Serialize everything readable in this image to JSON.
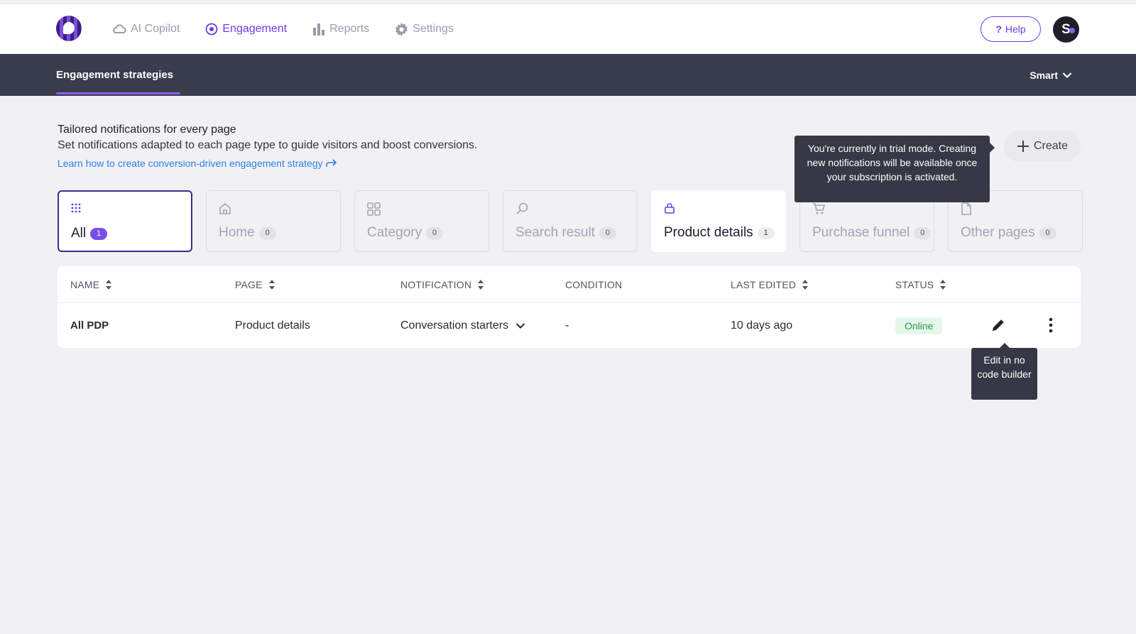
{
  "nav": {
    "items": [
      {
        "label": "AI Copilot",
        "icon": "cloud-icon",
        "active": false
      },
      {
        "label": "Engagement",
        "icon": "target-icon",
        "active": true
      },
      {
        "label": "Reports",
        "icon": "bar-chart-icon",
        "active": false
      },
      {
        "label": "Settings",
        "icon": "gear-icon",
        "active": false
      }
    ],
    "help_label": "Help",
    "avatar_initial": "S"
  },
  "subheader": {
    "tab_label": "Engagement strategies",
    "account_label": "Smart"
  },
  "intro": {
    "title": "Tailored notifications for every page",
    "description": "Set notifications adapted to each page type to guide visitors and boost conversions.",
    "link": "Learn how to create conversion-driven engagement strategy"
  },
  "create_label": "Create",
  "trial_tooltip": "You're currently in trial mode. Creating new notifications will be available once your subscription is activated.",
  "page_types": [
    {
      "label": "All",
      "count": "1",
      "icon": "grid-dots-icon",
      "state": "selected"
    },
    {
      "label": "Home",
      "count": "0",
      "icon": "home-icon",
      "state": "normal"
    },
    {
      "label": "Category",
      "count": "0",
      "icon": "category-icon",
      "state": "normal"
    },
    {
      "label": "Search result",
      "count": "0",
      "icon": "search-icon",
      "state": "normal"
    },
    {
      "label": "Product details",
      "count": "1",
      "icon": "shopping-bag-icon",
      "state": "highlight"
    },
    {
      "label": "Purchase funnel",
      "count": "0",
      "icon": "cart-icon",
      "state": "normal"
    },
    {
      "label": "Other pages",
      "count": "0",
      "icon": "file-icon",
      "state": "normal"
    }
  ],
  "table": {
    "headers": {
      "name": "NAME",
      "page": "PAGE",
      "notification": "NOTIFICATION",
      "condition": "CONDITION",
      "last_edited": "LAST EDITED",
      "status": "STATUS"
    },
    "rows": [
      {
        "name": "All PDP",
        "page": "Product details",
        "notification": "Conversation starters",
        "condition": "-",
        "last_edited": "10 days ago",
        "status": "Online"
      }
    ]
  },
  "edit_tooltip": "Edit in no code builder",
  "colors": {
    "accent": "#6a3de8",
    "subheader_bg": "#393c4c",
    "page_bg": "#f1f1f4",
    "online_text": "#2f9a4d",
    "online_bg": "#e5f6ea",
    "tooltip_bg": "#363945"
  }
}
